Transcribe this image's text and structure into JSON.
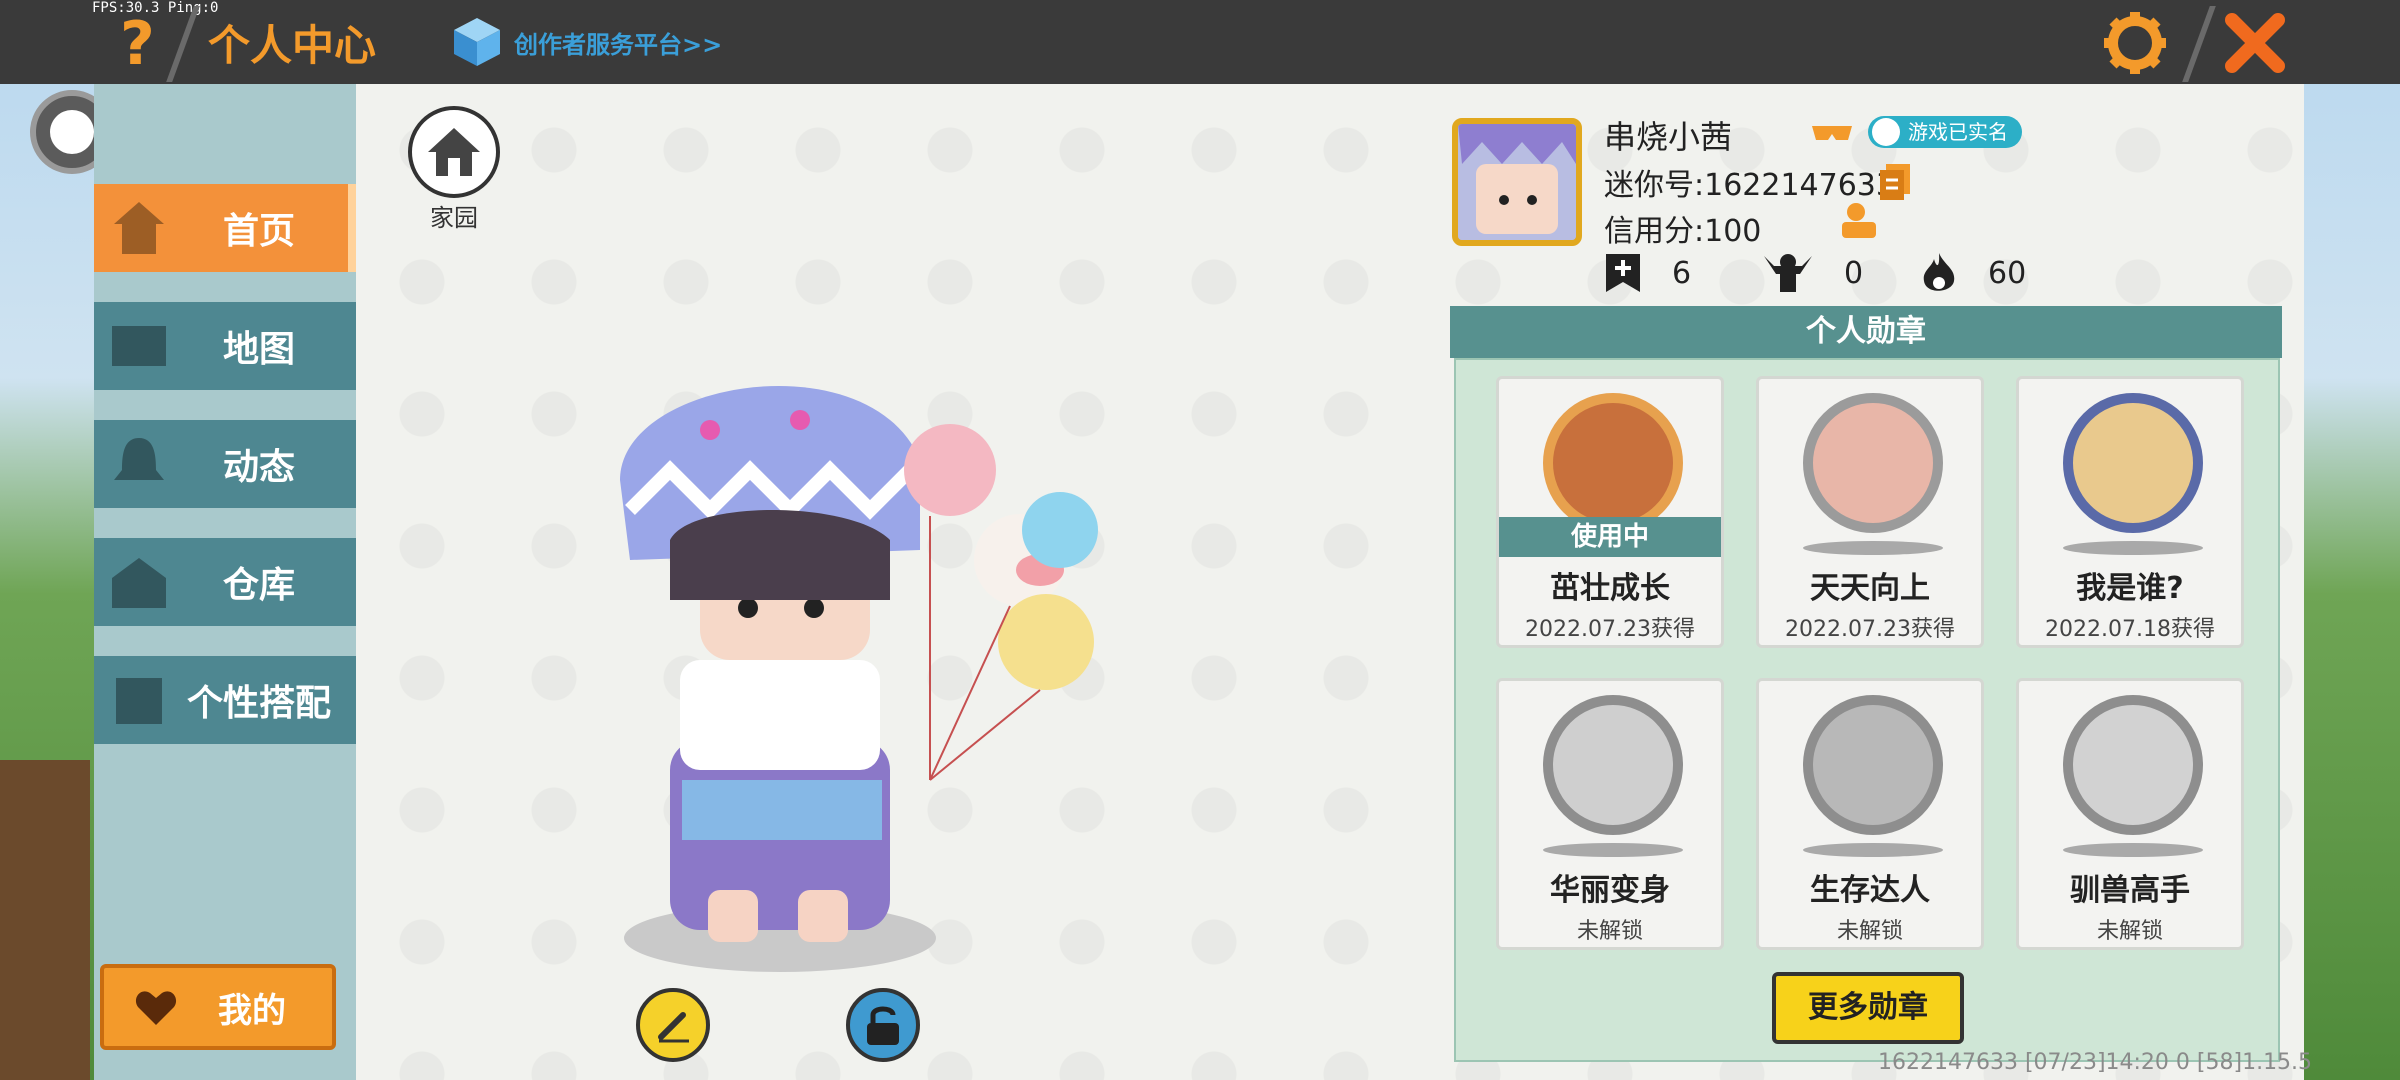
{
  "fps": "FPS:30.3  Ping:0",
  "header": {
    "title": "个人中心",
    "creator_link": "创作者服务平台>>"
  },
  "nav": [
    {
      "label": "首页",
      "active": true,
      "icon": "home-icon"
    },
    {
      "label": "地图",
      "active": false,
      "icon": "map-icon"
    },
    {
      "label": "动态",
      "active": false,
      "icon": "bell-icon"
    },
    {
      "label": "仓库",
      "active": false,
      "icon": "warehouse-icon"
    },
    {
      "label": "个性搭配",
      "active": false,
      "icon": "outfit-icon"
    }
  ],
  "my_button": "我的",
  "home": {
    "label": "家园"
  },
  "profile": {
    "name": "串烧小茜",
    "verified": "游戏已实名",
    "mini_id": "迷你号:1622147633",
    "credit": "信用分:100",
    "stats": [
      {
        "icon": "flag-plus-icon",
        "value": "6"
      },
      {
        "icon": "trophy-person-icon",
        "value": "0"
      },
      {
        "icon": "flame-icon",
        "value": "60"
      }
    ]
  },
  "badges": {
    "title": "个人勋章",
    "items": [
      {
        "name": "茁壮成长",
        "date": "2022.07.23获得",
        "in_use": "使用中",
        "color": "#3f6b2e"
      },
      {
        "name": "天天向上",
        "date": "2022.07.23获得",
        "in_use": "",
        "color": "#c9673a"
      },
      {
        "name": "我是谁?",
        "date": "2022.07.18获得",
        "in_use": "",
        "color": "#5a73b0"
      },
      {
        "name": "华丽变身",
        "date": "未解锁",
        "in_use": "",
        "color": "#9a9a9a"
      },
      {
        "name": "生存达人",
        "date": "未解锁",
        "in_use": "",
        "color": "#8a8a8a"
      },
      {
        "name": "驯兽高手",
        "date": "未解锁",
        "in_use": "",
        "color": "#9a9a9a"
      }
    ],
    "more": "更多勋章"
  },
  "footer": "1622147633    [07/23]14:20 0  [58]1.15.5"
}
